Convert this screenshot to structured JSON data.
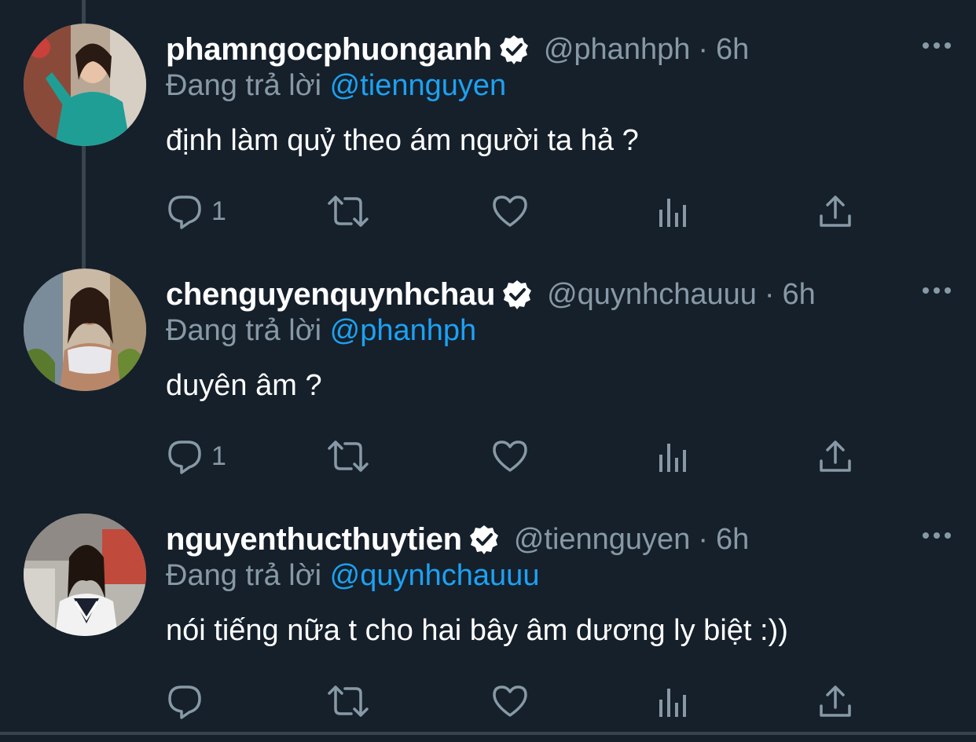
{
  "tweets": [
    {
      "display_name": "phamngocphuonganh",
      "handle": "@phanhph",
      "separator": "·",
      "time": "6h",
      "reply_prefix": "Đang trả lời",
      "reply_mention": "@tiennguyen",
      "text": "định làm quỷ theo ám người ta hả ?",
      "reply_count": "1",
      "verified": true
    },
    {
      "display_name": "chenguyenquynhchau",
      "handle": "@quynhchauuu",
      "separator": "·",
      "time": "6h",
      "reply_prefix": "Đang trả lời",
      "reply_mention": "@phanhph",
      "text": "duyên âm ?",
      "reply_count": "1",
      "verified": true
    },
    {
      "display_name": "nguyenthucthuytien",
      "handle": "@tiennguyen",
      "separator": "·",
      "time": "6h",
      "reply_prefix": "Đang trả lời",
      "reply_mention": "@quynhchauuu",
      "text": "nói tiếng nữa t cho hai bây âm dương ly biệt :))",
      "reply_count": "",
      "verified": true
    }
  ],
  "icons": {
    "reply": "reply-icon",
    "retweet": "retweet-icon",
    "like": "heart-icon",
    "analytics": "analytics-icon",
    "share": "share-icon",
    "more": "more-icon",
    "verified": "verified-badge-icon"
  },
  "colors": {
    "background": "#15202b",
    "text": "#ffffff",
    "muted": "#8899a6",
    "link": "#1da1f2",
    "divider": "#38444d"
  }
}
